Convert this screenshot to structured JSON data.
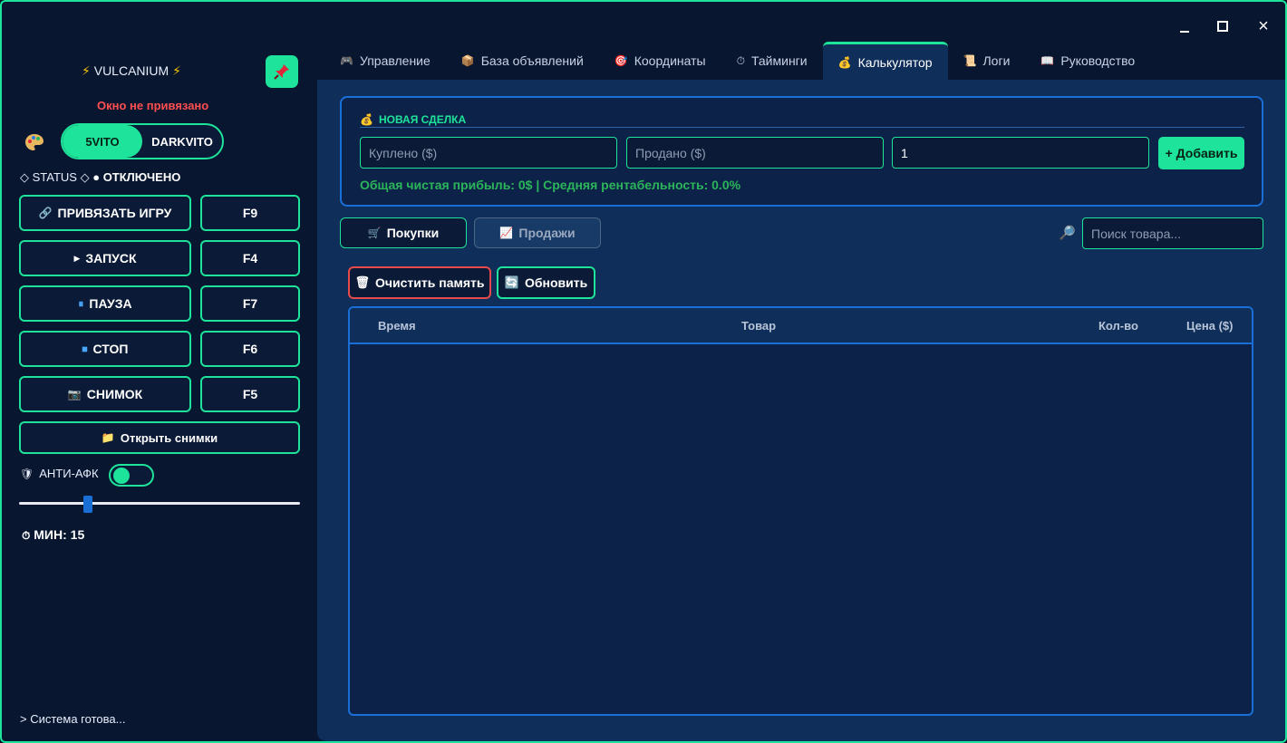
{
  "window": {
    "minimize_label": "minimize",
    "maximize_label": "maximize",
    "close_label": "×"
  },
  "sidebar": {
    "brand": "VULCANIUM",
    "brand_bolt": "⚡",
    "unbound_text": "Окно не привязано",
    "modes": [
      "5VITO",
      "DARKVITO"
    ],
    "active_mode": "5VITO",
    "status_label": "◇ STATUS ◇",
    "status_dot": "●",
    "status_value": "ОТКЛЮЧЕНО",
    "buttons": [
      {
        "icon": "🔗",
        "label": "ПРИВЯЗАТЬ ИГРУ",
        "key": "F9"
      },
      {
        "icon": "▶",
        "label": "ЗАПУСК",
        "key": "F4"
      },
      {
        "icon": "⏸",
        "label": "ПАУЗА",
        "key": "F7"
      },
      {
        "icon": "⏹",
        "label": "СТОП",
        "key": "F6"
      },
      {
        "icon": "📷",
        "label": "СНИМОК",
        "key": "F5"
      }
    ],
    "open_shots": {
      "icon": "📁",
      "label": "Открыть снимки"
    },
    "anti_afk": {
      "icon": "🛡",
      "label": "АНТИ-АФК",
      "enabled": true
    },
    "slider": {
      "value": 15,
      "min": 1,
      "max": 60
    },
    "timer_icon": "⏱",
    "min_label": "МИН: 15",
    "console": "> Система готова..."
  },
  "tabs": [
    {
      "icon": "🎮",
      "label": "Управление"
    },
    {
      "icon": "📦",
      "label": "База объявлений"
    },
    {
      "icon": "🎯",
      "label": "Координаты"
    },
    {
      "icon": "⏱",
      "label": "Тайминги"
    },
    {
      "icon": "💰",
      "label": "Калькулятор"
    },
    {
      "icon": "📜",
      "label": "Логи"
    },
    {
      "icon": "📖",
      "label": "Руководство"
    }
  ],
  "active_tab": "Калькулятор",
  "deal": {
    "icon": "💰",
    "title": "НОВАЯ СДЕЛКА",
    "bought_placeholder": "Куплено ($)",
    "sold_placeholder": "Продано ($)",
    "qty_value": "1",
    "add_label": "+ Добавить",
    "profit_text": "Общая чистая прибыль: 0$ | Средняя рентабельность: 0.0%"
  },
  "toolbar": {
    "buy_icon": "🛒",
    "buy_label": "Покупки",
    "sell_icon": "📈",
    "sell_label": "Продажи",
    "search_icon": "🔎",
    "search_placeholder": "Поиск товара...",
    "clear_icon": "🗑",
    "clear_label": "Очистить память",
    "refresh_icon": "🔄",
    "refresh_label": "Обновить"
  },
  "table": {
    "headers": [
      "Время",
      "Товар",
      "Кол-во",
      "Цена ($)"
    ],
    "rows": []
  },
  "colors": {
    "accent": "#1ee39a",
    "danger": "#ff4f4f",
    "panel": "#0f2f5a",
    "profit": "#2bb55a"
  }
}
